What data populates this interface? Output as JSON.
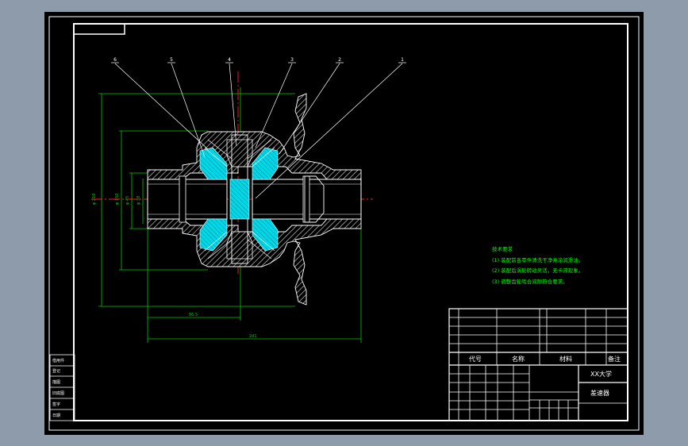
{
  "colors": {
    "viewport_bg": "#8d9bab",
    "sheet": "#000000",
    "frame": "#ffffff",
    "dimension": "#00c800",
    "center_line": "#ff2020",
    "hatch": "#bbbbbb",
    "cyan_part": "#00d8e8",
    "leader": "#ffffff",
    "tech_text": "#00ff00"
  },
  "balloons": [
    "6",
    "5",
    "4",
    "3",
    "2",
    "1"
  ],
  "dimensions": {
    "d_outer": "φ 210",
    "d_mid": "φ 150",
    "d_inner1": "φ 45",
    "d_inner2": "φ 38",
    "center_vertical": "120",
    "half_length": "86.5",
    "total_length": "241"
  },
  "tech_requirements": {
    "title": "技术要求",
    "lines": [
      "(1) 装配前各零件清洗干净并涂润滑油。",
      "(2) 装配后涡轮转动灵活，无卡滞现象。",
      "(3) 调整齿轮啮合间隙符合要求。"
    ]
  },
  "title_block": {
    "col_code": "代号",
    "col_name": "名称",
    "col_material": "材料",
    "col_remark": "备注",
    "school": "XX大学",
    "drawing_name": "差速器"
  },
  "side_table_rows": [
    "借用件",
    "登记",
    "描图",
    "旧底图",
    "签字",
    "日期"
  ]
}
